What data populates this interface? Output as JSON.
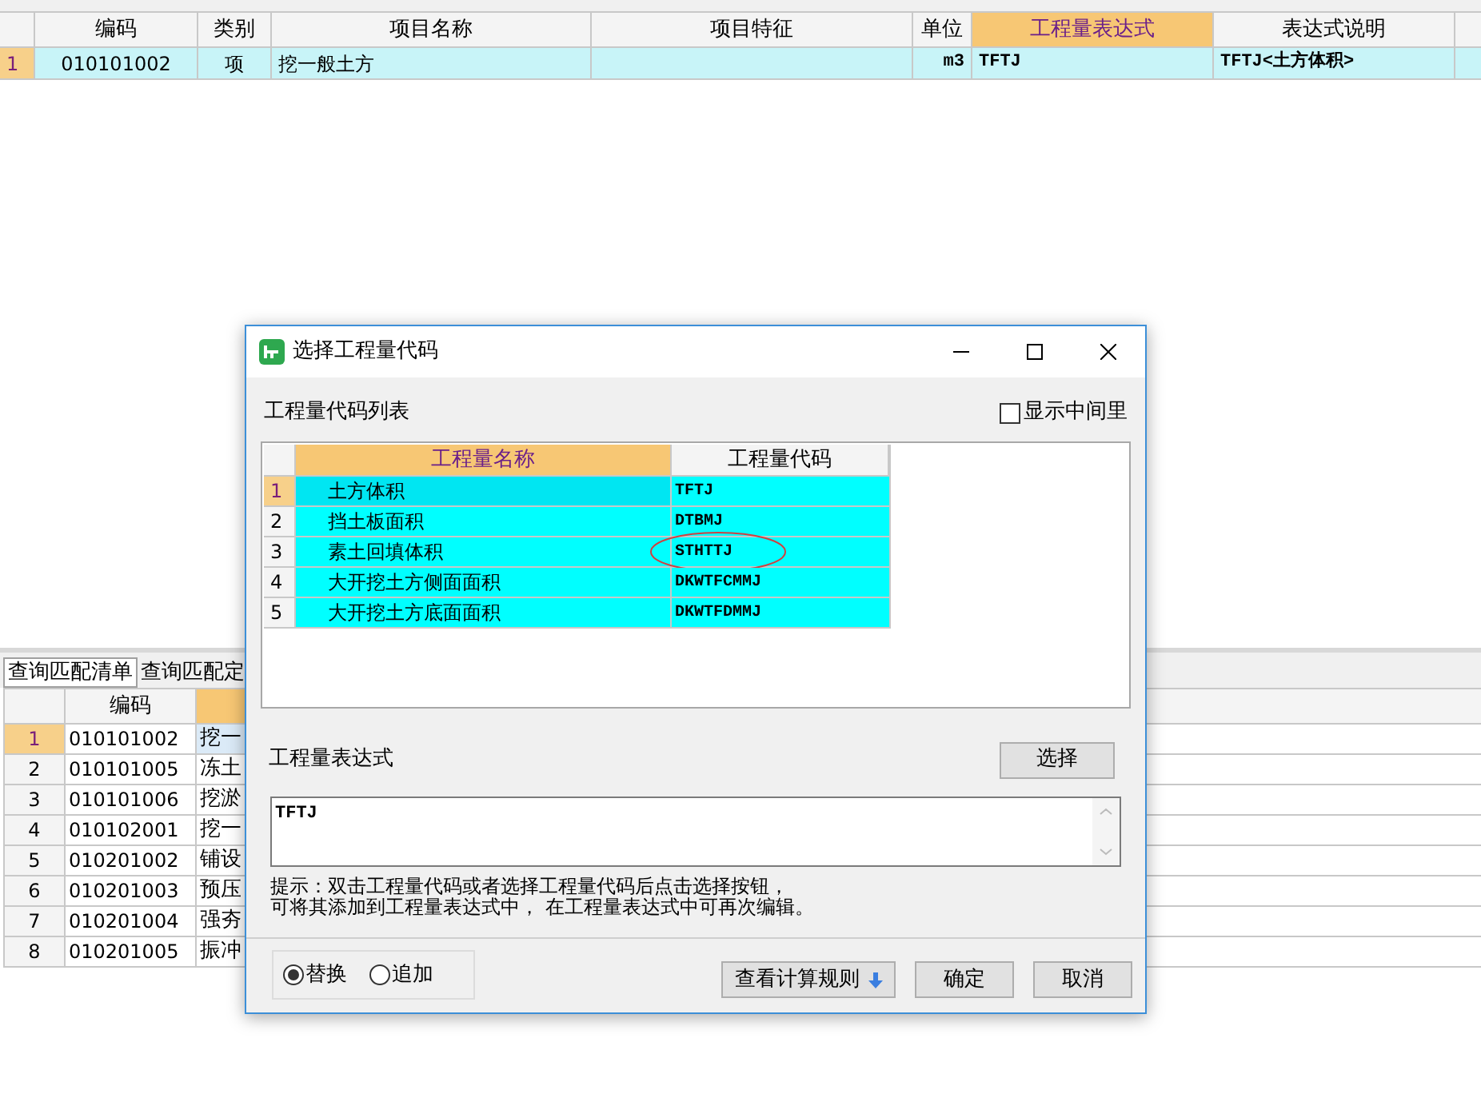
{
  "main_table": {
    "columns": [
      "编码",
      "类别",
      "项目名称",
      "项目特征",
      "单位",
      "工程量表达式",
      "表达式说明"
    ],
    "rows": [
      {
        "index": "1",
        "selected": true,
        "cells": [
          "010101002",
          "项",
          "挖一般土方",
          "",
          "m3",
          "TFTJ",
          "TFTJ<土方体积>"
        ]
      }
    ]
  },
  "bottom_tabs": [
    {
      "label": "查询匹配清单",
      "selected": true
    },
    {
      "label": "查询匹配定",
      "selected": false
    }
  ],
  "bottom_table": {
    "columns": [
      "编码",
      ""
    ],
    "rows": [
      {
        "index": "1",
        "selected": true,
        "code": "010101002",
        "name": "挖一"
      },
      {
        "index": "2",
        "selected": false,
        "code": "010101005",
        "name": "冻土"
      },
      {
        "index": "3",
        "selected": false,
        "code": "010101006",
        "name": "挖淤"
      },
      {
        "index": "4",
        "selected": false,
        "code": "010102001",
        "name": "挖一"
      },
      {
        "index": "5",
        "selected": false,
        "code": "010201002",
        "name": "铺设"
      },
      {
        "index": "6",
        "selected": false,
        "code": "010201003",
        "name": "预压"
      },
      {
        "index": "7",
        "selected": false,
        "code": "010201004",
        "name": "强夯"
      },
      {
        "index": "8",
        "selected": false,
        "code": "010201005",
        "name": "振冲"
      }
    ]
  },
  "dialog": {
    "title": "选择工程量代码",
    "list_label": "工程量代码列表",
    "show_intermediate": {
      "label": "显示中间里",
      "checked": false
    },
    "code_table": {
      "columns": [
        "工程量名称",
        "工程量代码"
      ],
      "rows": [
        {
          "index": "1",
          "selected": true,
          "circled": false,
          "name": "土方体积",
          "code": "TFTJ"
        },
        {
          "index": "2",
          "selected": false,
          "circled": false,
          "name": "挡土板面积",
          "code": "DTBMJ"
        },
        {
          "index": "3",
          "selected": false,
          "circled": true,
          "name": "素土回填体积",
          "code": "STHTTJ"
        },
        {
          "index": "4",
          "selected": false,
          "circled": false,
          "name": "大开挖土方侧面面积",
          "code": "DKWTFCMMJ"
        },
        {
          "index": "5",
          "selected": false,
          "circled": false,
          "name": "大开挖土方底面面积",
          "code": "DKWTFDMMJ"
        }
      ]
    },
    "expression_label": "工程量表达式",
    "select_button": "选择",
    "expression": "TFTJ",
    "hint": [
      "提示：双击工程量代码或者选择工程量代码后点击选择按钮，",
      "可将其添加到工程量表达式中， 在工程量表达式中可再次编辑。"
    ],
    "mode_options": [
      {
        "label": "替换",
        "selected": true
      },
      {
        "label": "追加",
        "selected": false
      }
    ],
    "buttons": [
      {
        "label": "查看计算规则",
        "kind": "dropdown"
      },
      {
        "label": "确定",
        "kind": "plain"
      },
      {
        "label": "取消",
        "kind": "plain"
      }
    ]
  }
}
